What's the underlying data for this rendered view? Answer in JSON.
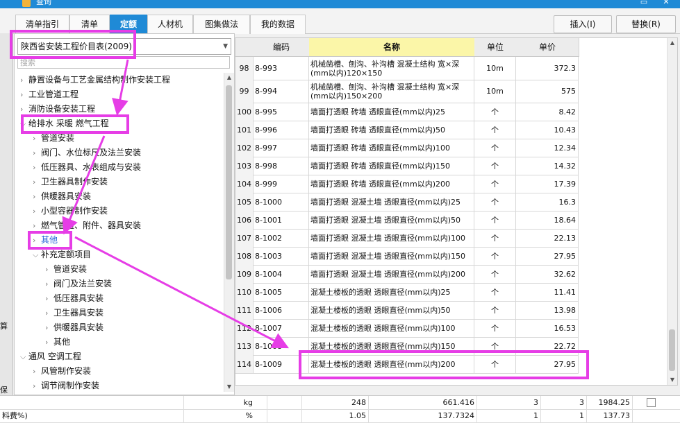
{
  "window": {
    "title": "查询",
    "controls": {
      "maximize": "▭",
      "close": "✕"
    }
  },
  "tabs": [
    {
      "label": "清单指引",
      "active": false
    },
    {
      "label": "清单",
      "active": false
    },
    {
      "label": "定额",
      "active": true
    },
    {
      "label": "人材机",
      "active": false
    },
    {
      "label": "图集做法",
      "active": false
    },
    {
      "label": "我的数据",
      "active": false
    }
  ],
  "actions": {
    "insert": "插入(I)",
    "replace": "替换(R)"
  },
  "left_strip_labels": [
    "算",
    "保温"
  ],
  "left": {
    "combo_value": "陕西省安装工程价目表(2009)",
    "search_placeholder": "搜索",
    "tree": [
      {
        "label": "静置设备与工艺金属结构制作安装工程",
        "level": 0,
        "expanded": false
      },
      {
        "label": "工业管道工程",
        "level": 0,
        "expanded": false
      },
      {
        "label": "消防设备安装工程",
        "level": 0,
        "expanded": false
      },
      {
        "label": "给排水 采暖 燃气工程",
        "level": 0,
        "expanded": true
      },
      {
        "label": "管道安装",
        "level": 1,
        "expanded": false
      },
      {
        "label": "阀门、水位标尺及法兰安装",
        "level": 1,
        "expanded": false
      },
      {
        "label": "低压器具、水表组成与安装",
        "level": 1,
        "expanded": false
      },
      {
        "label": "卫生器具制作安装",
        "level": 1,
        "expanded": false
      },
      {
        "label": "供暖器具安装",
        "level": 1,
        "expanded": false
      },
      {
        "label": "小型容器制作安装",
        "level": 1,
        "expanded": false
      },
      {
        "label": "燃气管道、附件、器具安装",
        "level": 1,
        "expanded": false
      },
      {
        "label": "其他",
        "level": 1,
        "expanded": false,
        "selected": true
      },
      {
        "label": "补充定额项目",
        "level": 1,
        "expanded": true
      },
      {
        "label": "管道安装",
        "level": 2,
        "expanded": false
      },
      {
        "label": "阀门及法兰安装",
        "level": 2,
        "expanded": false
      },
      {
        "label": "低压器具安装",
        "level": 2,
        "expanded": false
      },
      {
        "label": "卫生器具安装",
        "level": 2,
        "expanded": false
      },
      {
        "label": "供暖器具安装",
        "level": 2,
        "expanded": false
      },
      {
        "label": "其他",
        "level": 2,
        "expanded": false
      },
      {
        "label": "通风 空调工程",
        "level": 0,
        "expanded": true
      },
      {
        "label": "风管制作安装",
        "level": 1,
        "expanded": false
      },
      {
        "label": "调节阀制作安装",
        "level": 1,
        "expanded": false
      }
    ]
  },
  "grid": {
    "headers": {
      "code": "编码",
      "name": "名称",
      "unit": "单位",
      "price": "单价"
    },
    "rows": [
      {
        "idx": "98",
        "code": "8-993",
        "name": "机械凿槽、刨沟、补沟槽 混凝土结构 宽×深(mm以内)120×150",
        "unit": "10m",
        "price": "372.3"
      },
      {
        "idx": "99",
        "code": "8-994",
        "name": "机械凿槽、刨沟、补沟槽 混凝土结构 宽×深(mm以内)150×200",
        "unit": "10m",
        "price": "575"
      },
      {
        "idx": "100",
        "code": "8-995",
        "name": "墙面打透眼 砖墙 透眼直径(mm以内)25",
        "unit": "个",
        "price": "8.42"
      },
      {
        "idx": "101",
        "code": "8-996",
        "name": "墙面打透眼 砖墙 透眼直径(mm以内)50",
        "unit": "个",
        "price": "10.43"
      },
      {
        "idx": "102",
        "code": "8-997",
        "name": "墙面打透眼 砖墙 透眼直径(mm以内)100",
        "unit": "个",
        "price": "12.34"
      },
      {
        "idx": "103",
        "code": "8-998",
        "name": "墙面打透眼 砖墙 透眼直径(mm以内)150",
        "unit": "个",
        "price": "14.32"
      },
      {
        "idx": "104",
        "code": "8-999",
        "name": "墙面打透眼 砖墙 透眼直径(mm以内)200",
        "unit": "个",
        "price": "17.39"
      },
      {
        "idx": "105",
        "code": "8-1000",
        "name": "墙面打透眼 混凝土墙 透眼直径(mm以内)25",
        "unit": "个",
        "price": "16.3"
      },
      {
        "idx": "106",
        "code": "8-1001",
        "name": "墙面打透眼 混凝土墙 透眼直径(mm以内)50",
        "unit": "个",
        "price": "18.64"
      },
      {
        "idx": "107",
        "code": "8-1002",
        "name": "墙面打透眼 混凝土墙 透眼直径(mm以内)100",
        "unit": "个",
        "price": "22.13"
      },
      {
        "idx": "108",
        "code": "8-1003",
        "name": "墙面打透眼 混凝土墙 透眼直径(mm以内)150",
        "unit": "个",
        "price": "27.95"
      },
      {
        "idx": "109",
        "code": "8-1004",
        "name": "墙面打透眼 混凝土墙 透眼直径(mm以内)200",
        "unit": "个",
        "price": "32.62"
      },
      {
        "idx": "110",
        "code": "8-1005",
        "name": "混凝土楼板的透眼 透眼直径(mm以内)25",
        "unit": "个",
        "price": "11.41"
      },
      {
        "idx": "111",
        "code": "8-1006",
        "name": "混凝土楼板的透眼 透眼直径(mm以内)50",
        "unit": "个",
        "price": "13.98"
      },
      {
        "idx": "112",
        "code": "8-1007",
        "name": "混凝土楼板的透眼 透眼直径(mm以内)100",
        "unit": "个",
        "price": "16.53"
      },
      {
        "idx": "113",
        "code": "8-1008",
        "name": "混凝土楼板的透眼 透眼直径(mm以内)150",
        "unit": "个",
        "price": "22.72"
      },
      {
        "idx": "114",
        "code": "8-1009",
        "name": "混凝土楼板的透眼 透眼直径(mm以内)200",
        "unit": "个",
        "price": "27.95"
      }
    ]
  },
  "bottom": {
    "rows": [
      {
        "label": "",
        "unit": "kg",
        "v1": "248",
        "v2": "661.416",
        "v3": "3",
        "v4": "3",
        "v5": "1984.25"
      },
      {
        "label": "料费%)",
        "unit": "%",
        "v1": "1.05",
        "v2": "137.7324",
        "v3": "1",
        "v4": "1",
        "v5": "137.73"
      }
    ]
  },
  "colors": {
    "accent": "#1f8ad6",
    "highlight": "#e63de6",
    "header_name_bg": "#fbf6a8"
  }
}
